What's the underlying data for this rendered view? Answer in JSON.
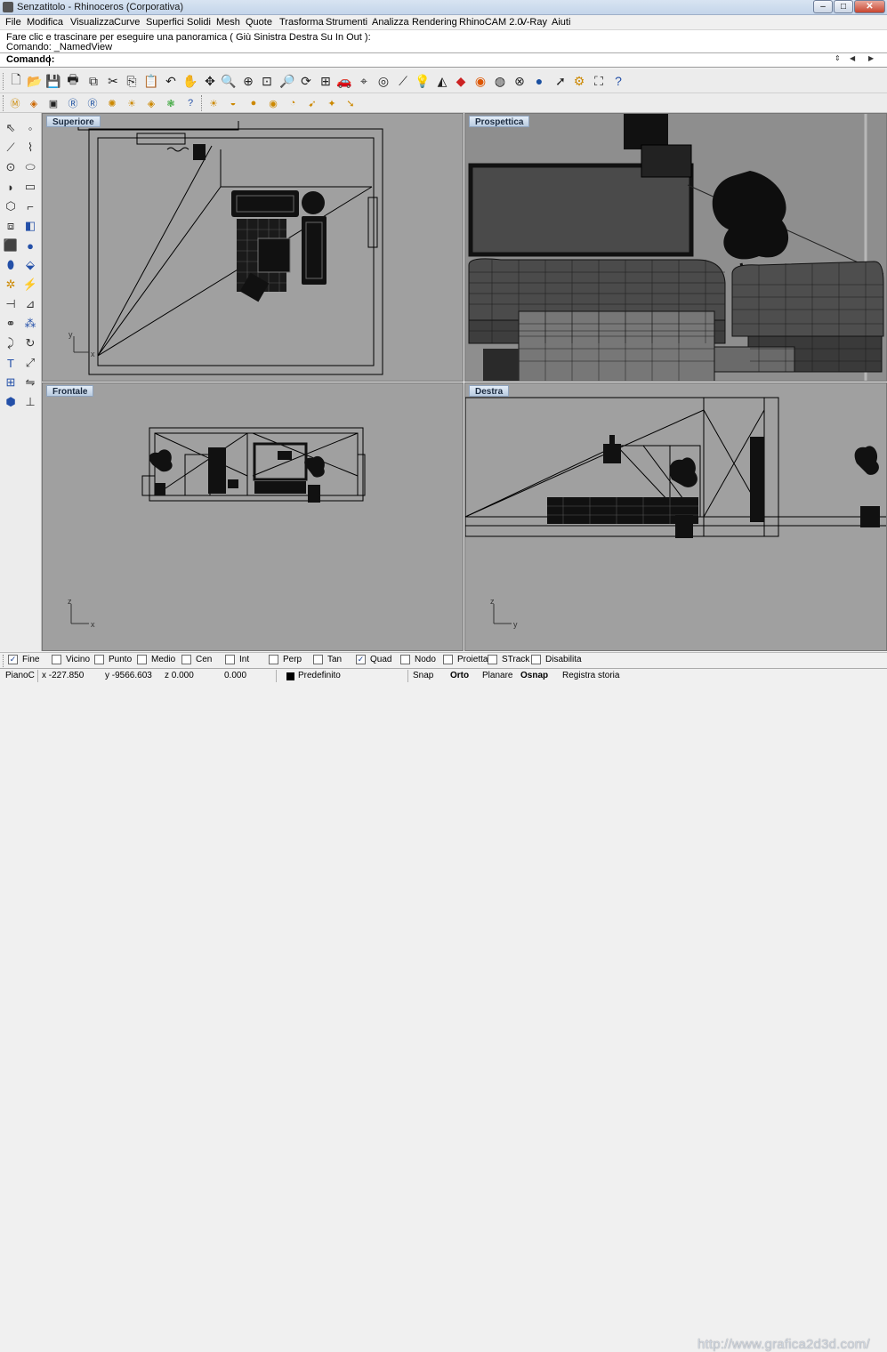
{
  "window": {
    "title": "Senzatitolo - Rhinoceros (Corporativa)",
    "minimize": "–",
    "maximize": "□",
    "close": "✕"
  },
  "menu": [
    "File",
    "Modifica",
    "Visualizza",
    "Curve",
    "Superfici",
    "Solidi",
    "Mesh",
    "Quote",
    "Trasforma",
    "Strumenti",
    "Analizza",
    "Rendering",
    "RhinoCAM 2.0",
    "V-Ray",
    "Aiuti"
  ],
  "history": {
    "line1": "Fare clic e trascinare per eseguire una panoramica ( Giù  Sinistra  Destra  Su  In  Out ):",
    "line2": "Comando: _NamedView"
  },
  "command": {
    "label": "Comando:",
    "value": ""
  },
  "toolbar_main_icons": [
    "new-file",
    "open-folder",
    "save",
    "print",
    "import",
    "cut",
    "copy",
    "paste",
    "undo",
    "pan",
    "move-view",
    "zoom-dynamic",
    "zoom-extents",
    "zoom-window",
    "zoom-selected",
    "rotate-view",
    "four-viewports",
    "car",
    "set-cplane",
    "world",
    "line-tool",
    "lightbulb",
    "shaded",
    "rendered",
    "color-wheel",
    "ghosted",
    "wireframe-sphere",
    "render-sphere",
    "pointer",
    "gear",
    "properties",
    "help"
  ],
  "toolbar_vray_icons": [
    "vray-material",
    "vray-options",
    "vray-save",
    "vray-rt",
    "vray-rt2",
    "vray-frame",
    "vray-help",
    "sun",
    "light-plane",
    "render-vfb",
    "help"
  ],
  "toolbar_vray_icons2": [
    "sun",
    "dome",
    "sphere-light",
    "sphere-light2",
    "spot-light",
    "ies-light",
    "omni-light"
  ],
  "viewports": {
    "top": {
      "label": "Superiore",
      "axis_y": "y",
      "axis_x": "x"
    },
    "perspective": {
      "label": "Prospettica"
    },
    "front": {
      "label": "Frontale",
      "axis_z": "z",
      "axis_x": "x"
    },
    "right": {
      "label": "Destra",
      "axis_z": "z",
      "axis_y": "y"
    }
  },
  "osnap": [
    {
      "label": "Fine",
      "checked": true
    },
    {
      "label": "Vicino",
      "checked": false
    },
    {
      "label": "Punto",
      "checked": false
    },
    {
      "label": "Medio",
      "checked": false
    },
    {
      "label": "Cen",
      "checked": false
    },
    {
      "label": "Int",
      "checked": false
    },
    {
      "label": "Perp",
      "checked": false
    },
    {
      "label": "Tan",
      "checked": false
    },
    {
      "label": "Quad",
      "checked": true
    },
    {
      "label": "Nodo",
      "checked": false
    },
    {
      "label": "Proietta",
      "checked": false
    },
    {
      "label": "STrack",
      "checked": false
    },
    {
      "label": "Disabilita",
      "checked": false
    }
  ],
  "status": {
    "cplane": "PianoC",
    "x": "x -227.850",
    "y": "y -9566.603",
    "z": "z 0.000",
    "d": "0.000",
    "layer": "Predefinito",
    "snap": "Snap",
    "ortho": "Orto",
    "planar": "Planare",
    "osnap": "Osnap",
    "history": "Registra storia"
  },
  "watermark": "http://www.grafica2d3d.com/",
  "check_mark": "✓"
}
